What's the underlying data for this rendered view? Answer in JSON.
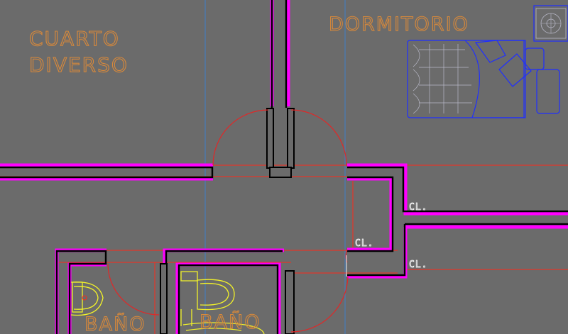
{
  "rooms": {
    "diverse_room": {
      "line1": "CUARTO",
      "line2": "DIVERSO"
    },
    "bedroom": "DORMITORIO",
    "bathroom_left": "BAÑO",
    "bathroom_right": "BAÑO"
  },
  "closets": {
    "hall_closet": "CL.",
    "upper_closet": "CL.",
    "lower_closet": "CL."
  },
  "colors": {
    "background": "#6b6b6b",
    "wall_outline": "#ff00ff",
    "wall_core": "#000000",
    "label_text": "#d9893a",
    "door_swing": "#e02828",
    "sanitary_fixture": "#f1f12a",
    "furniture": "#1f2fff",
    "reference_line_blue": "#3f7fc8",
    "reference_line_red": "#ff2a1a"
  },
  "icons": {
    "bed": "bed-icon",
    "pillow": "pillow-icon",
    "nightstand": "nightstand-icon",
    "toilet": "toilet-icon",
    "door_swing": "door-swing-icon"
  }
}
